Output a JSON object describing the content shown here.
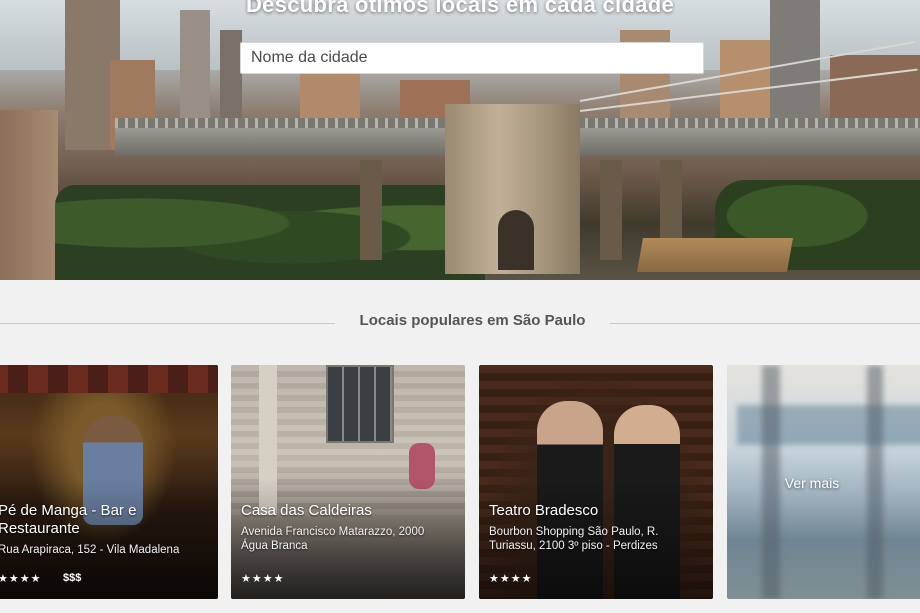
{
  "hero": {
    "title": "Descubra ótimos locais em cada cidade",
    "search_placeholder": "Nome da cidade"
  },
  "section": {
    "title": "Locais populares em São Paulo"
  },
  "cards": [
    {
      "name": "Pé de Manga - Bar e Restaurante",
      "address": "Rua Arapiraca, 152 - Vila Madalena",
      "stars": "★★★★",
      "price": "$$$"
    },
    {
      "name": "Casa das Caldeiras",
      "address": "Avenida Francisco Matarazzo, 2000 Água Branca",
      "stars": "★★★★"
    },
    {
      "name": "Teatro Bradesco",
      "address": "Bourbon Shopping São Paulo, R. Turiassu, 2100 3º piso - Perdizes",
      "stars": "★★★★"
    }
  ],
  "more_label": "Ver mais"
}
